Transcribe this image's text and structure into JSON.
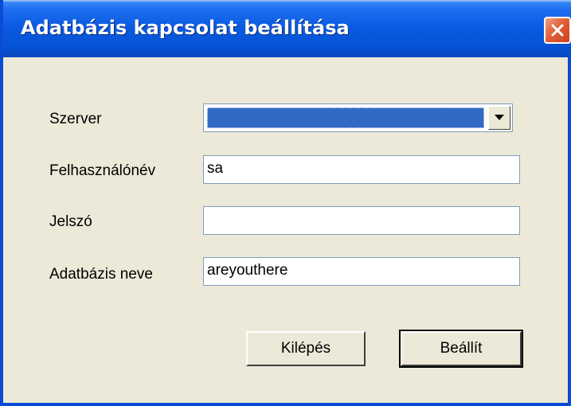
{
  "window": {
    "title": "Adatbázis kapcsolat beállítása"
  },
  "form": {
    "server_label": "Szerver",
    "server_value": "",
    "username_label": "Felhasználónév",
    "username_value": "sa",
    "password_label": "Jelszó",
    "password_value": "",
    "database_label": "Adatbázis neve",
    "database_value": "areyouthere"
  },
  "buttons": {
    "exit_label": "Kilépés",
    "set_label": "Beállít"
  },
  "icons": {
    "close": "close-icon",
    "dropdown": "chevron-down-icon"
  },
  "colors": {
    "title_bar": "#0a5be2",
    "close_button": "#e2613c",
    "dialog_background": "#ece9d8",
    "selection_highlight": "#316ac5"
  }
}
